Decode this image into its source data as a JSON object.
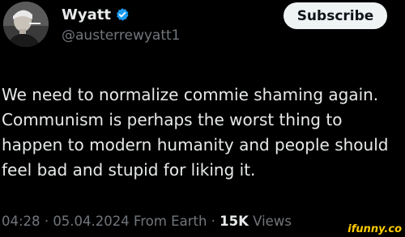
{
  "user": {
    "display_name": "Wyatt",
    "handle": "@austerrewyatt1",
    "verified": true
  },
  "actions": {
    "subscribe_label": "Subscribe"
  },
  "tweet": {
    "lines": [
      "We need to normalize commie shaming again.",
      "Communism is perhaps the worst thing to",
      "happen to modern humanity and people should",
      "feel bad and stupid for liking it."
    ]
  },
  "meta": {
    "time": "04:28",
    "date": "05.04.2024",
    "source": "From Earth",
    "views_count": "15K",
    "views_label": "Views",
    "separator": "·"
  },
  "watermark": {
    "text": "ifunny.co"
  },
  "colors": {
    "background": "#000000",
    "text_primary": "#e7e9ea",
    "text_secondary": "#71767b",
    "verified_blue": "#1d9bf0",
    "button_bg": "#eff3f4",
    "watermark": "#ffcc00"
  },
  "icons": {
    "verified": "verified-badge-icon"
  }
}
